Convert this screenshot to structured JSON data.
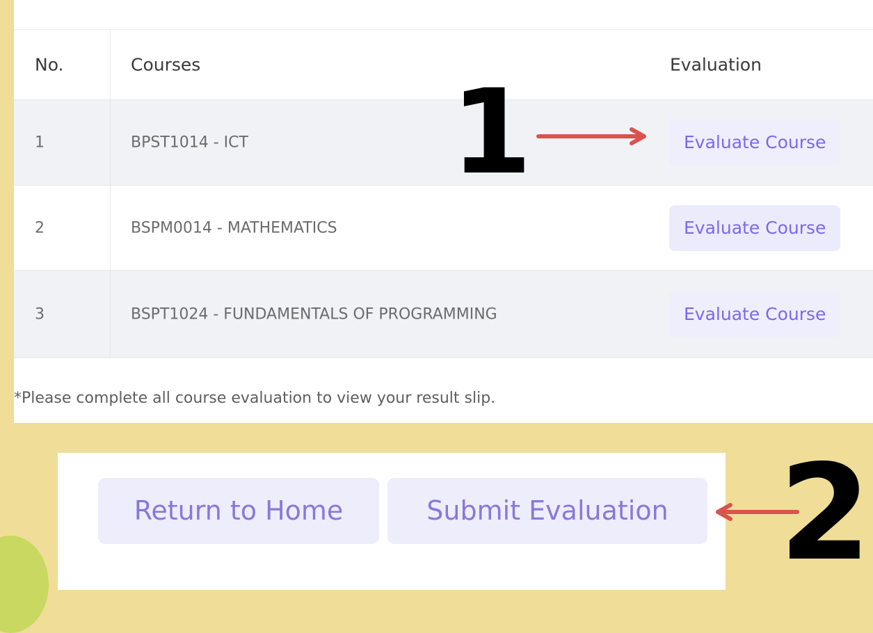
{
  "table": {
    "headers": {
      "no": "No.",
      "courses": "Courses",
      "evaluation": "Evaluation"
    },
    "rows": [
      {
        "no": "1",
        "course": "BPST1014 - ICT",
        "action": "Evaluate Course"
      },
      {
        "no": "2",
        "course": "BSPM0014 - MATHEMATICS",
        "action": "Evaluate Course"
      },
      {
        "no": "3",
        "course": "BSPT1024 - FUNDAMENTALS OF PROGRAMMING",
        "action": "Evaluate Course"
      }
    ],
    "note": "*Please complete all course evaluation to view your result slip."
  },
  "actions": {
    "return_home": "Return to Home",
    "submit_evaluation": "Submit Evaluation"
  },
  "annotations": {
    "marker_1": "1",
    "marker_2": "2"
  },
  "colors": {
    "background": "#f0dd98",
    "panel": "#ffffff",
    "button_bg": "#efeefc",
    "button_text": "#7b68ee",
    "arrow": "#d9534f",
    "marker": "#000000"
  },
  "icons": {
    "arrow_1": "right-arrow-icon",
    "arrow_2": "left-arrow-icon"
  }
}
